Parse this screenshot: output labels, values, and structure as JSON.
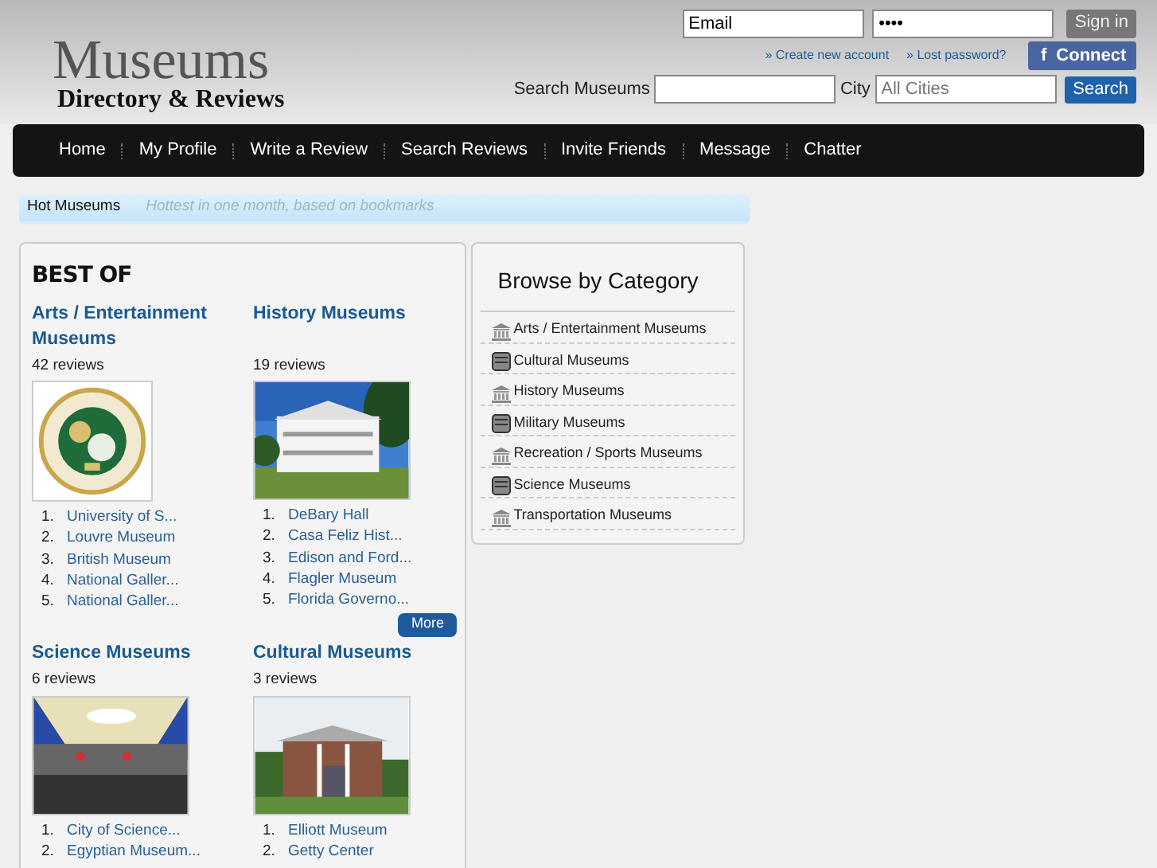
{
  "header": {
    "logo_title": "Museums",
    "logo_subtitle": "Directory & Reviews",
    "email_field": {
      "value": "Email"
    },
    "password_field": {
      "value": "••••"
    },
    "sign_in": "Sign in",
    "links": [
      "» Create new account",
      "» Lost password?"
    ],
    "connect": {
      "icon": "f",
      "label": "Connect"
    },
    "search_label": "Search Museums",
    "city_label": "City",
    "city_field": {
      "placeholder": "All Cities"
    },
    "search_button": "Search"
  },
  "nav": [
    "Home",
    "My Profile",
    "Write a Review",
    "Search Reviews",
    "Invite Friends",
    "Message",
    "Chatter"
  ],
  "hot_bar": {
    "title": "Hot Museums",
    "subtitle": "Hottest in one month, based on bookmarks"
  },
  "best_of": {
    "title": "BEST OF",
    "sections": [
      {
        "title": "Arts / Entertainment Museums",
        "reviews": "42 reviews",
        "items": [
          {
            "number": "1.",
            "name": "University of S..."
          },
          {
            "number": "2.",
            "name": "Louvre Museum"
          },
          {
            "number": "3.",
            "name": "British Museum"
          },
          {
            "number": "4.",
            "name": "National Galler..."
          },
          {
            "number": "5.",
            "name": "National Galler..."
          }
        ]
      },
      {
        "title": "History Museums",
        "reviews": "19 reviews",
        "items": [
          {
            "number": "1.",
            "name": "DeBary Hall"
          },
          {
            "number": "2.",
            "name": "Casa Feliz Hist..."
          },
          {
            "number": "3.",
            "name": "Edison and Ford..."
          },
          {
            "number": "4.",
            "name": "Flagler Museum"
          },
          {
            "number": "5.",
            "name": "Florida Governo..."
          }
        ],
        "more": "More"
      },
      {
        "title": "Science Museums",
        "reviews": "6 reviews",
        "items": [
          {
            "number": "1.",
            "name": "City of Science..."
          },
          {
            "number": "2.",
            "name": "Egyptian Museum..."
          }
        ]
      },
      {
        "title": "Cultural Museums",
        "reviews": "3 reviews",
        "items": [
          {
            "number": "1.",
            "name": "Elliott Museum"
          },
          {
            "number": "2.",
            "name": "Getty Center"
          }
        ]
      }
    ]
  },
  "categories": {
    "title": "Browse by Category",
    "items": [
      {
        "kind": "building",
        "label": "Arts / Entertainment Museums"
      },
      {
        "kind": "tablet",
        "label": "Cultural Museums"
      },
      {
        "kind": "building",
        "label": "History Museums"
      },
      {
        "kind": "tablet",
        "label": "Military Museums"
      },
      {
        "kind": "building",
        "label": "Recreation / Sports Museums"
      },
      {
        "kind": "tablet",
        "label": "Science Museums"
      },
      {
        "kind": "building",
        "label": "Transportation Museums"
      }
    ]
  }
}
